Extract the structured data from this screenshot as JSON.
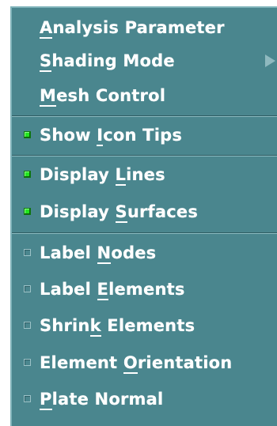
{
  "menu": {
    "items": [
      {
        "label_pre": "",
        "label_mnemonic": "A",
        "label_post": "nalysis Parameter",
        "checkbox": null,
        "submenu": false
      },
      {
        "label_pre": "",
        "label_mnemonic": "S",
        "label_post": "hading Mode",
        "checkbox": null,
        "submenu": true
      },
      {
        "label_pre": "",
        "label_mnemonic": "M",
        "label_post": "esh Control",
        "checkbox": null,
        "submenu": false
      },
      {
        "label_pre": "Show ",
        "label_mnemonic": "I",
        "label_post": "con Tips",
        "checkbox": true,
        "submenu": false
      },
      {
        "label_pre": "Display ",
        "label_mnemonic": "L",
        "label_post": "ines",
        "checkbox": true,
        "submenu": false
      },
      {
        "label_pre": "Display ",
        "label_mnemonic": "S",
        "label_post": "urfaces",
        "checkbox": true,
        "submenu": false
      },
      {
        "label_pre": "Label ",
        "label_mnemonic": "N",
        "label_post": "odes",
        "checkbox": false,
        "submenu": false
      },
      {
        "label_pre": "Label ",
        "label_mnemonic": "E",
        "label_post": "lements",
        "checkbox": false,
        "submenu": false
      },
      {
        "label_pre": "Shrin",
        "label_mnemonic": "k",
        "label_post": " Elements",
        "checkbox": false,
        "submenu": false
      },
      {
        "label_pre": "Element ",
        "label_mnemonic": "O",
        "label_post": "rientation",
        "checkbox": false,
        "submenu": false
      },
      {
        "label_pre": "",
        "label_mnemonic": "P",
        "label_post": "late Normal",
        "checkbox": false,
        "submenu": false
      }
    ]
  },
  "icons": {
    "submenu_arrow": "triangle-right-icon",
    "checkbox_on": "checkbox-checked-icon",
    "checkbox_off": "checkbox-unchecked-icon"
  },
  "colors": {
    "menu_background": "#4a868e",
    "text": "#ffffff",
    "check_on": "#22e61e"
  }
}
